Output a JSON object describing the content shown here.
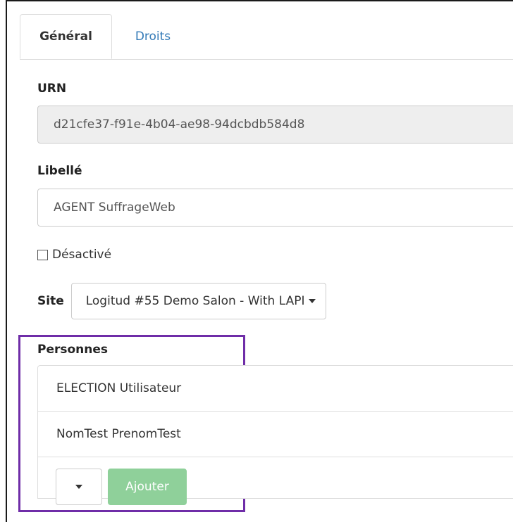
{
  "tabs": {
    "general": "Général",
    "droits": "Droits"
  },
  "urn": {
    "label": "URN",
    "value": "d21cfe37-f91e-4b04-ae98-94dcbdb584d8"
  },
  "libelle": {
    "label": "Libellé",
    "value": "AGENT SuffrageWeb"
  },
  "desactive": {
    "label": "Désactivé",
    "checked": false
  },
  "site": {
    "label": "Site",
    "selected": "Logitud #55 Demo Salon - With LAPI"
  },
  "personnes": {
    "label": "Personnes",
    "items": [
      "ELECTION Utilisateur",
      "NomTest PrenomTest"
    ],
    "add_label": "Ajouter"
  },
  "colors": {
    "highlight": "#6f2da8",
    "add_button": "#8fd09a",
    "link": "#337ab7"
  }
}
